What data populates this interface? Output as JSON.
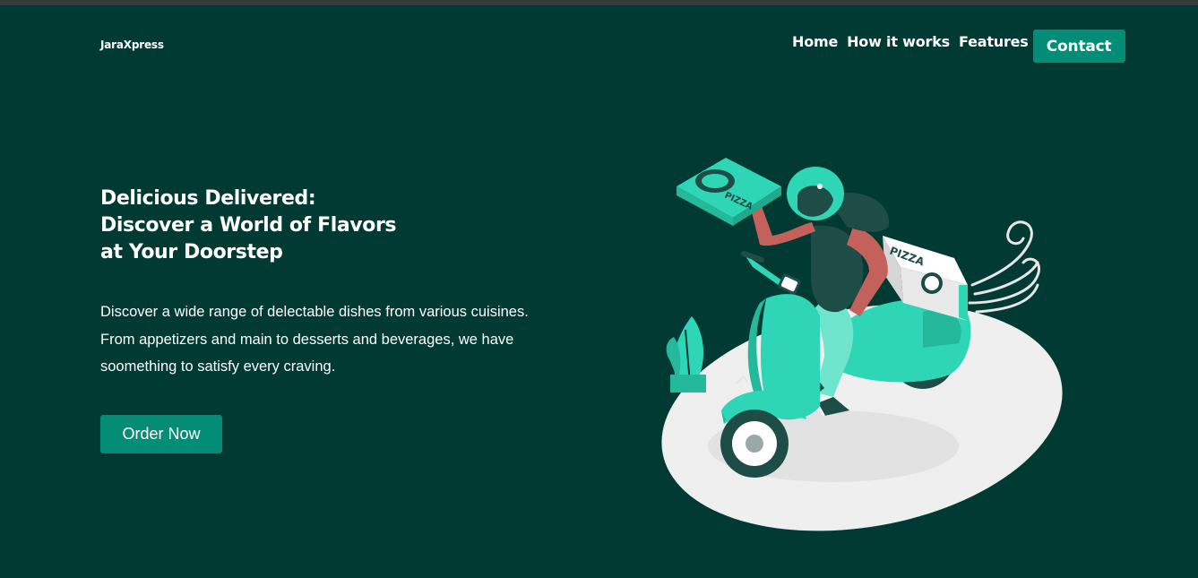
{
  "brand": {
    "name": "JaraXpress"
  },
  "nav": {
    "items": [
      {
        "label": "Home"
      },
      {
        "label": "How it works"
      },
      {
        "label": "Features"
      }
    ],
    "contact_label": "Contact"
  },
  "hero": {
    "title_lines": [
      "Delicious Delivered:",
      "Discover a World of Flavors",
      "at Your Doorstep"
    ],
    "description_lines": [
      "Discover a wide range of delectable dishes from various cuisines.",
      "From appetizers and main to desserts and beverages, we have",
      "soomething to satisfy every craving."
    ],
    "cta_label": "Order Now"
  },
  "illustration": {
    "subject": "delivery-rider-on-scooter-with-pizza",
    "box_text": "PIZZA"
  },
  "colors": {
    "background": "#013a33",
    "accent": "#038c76",
    "scooter": "#2ed6b6",
    "text": "#ffffff"
  }
}
